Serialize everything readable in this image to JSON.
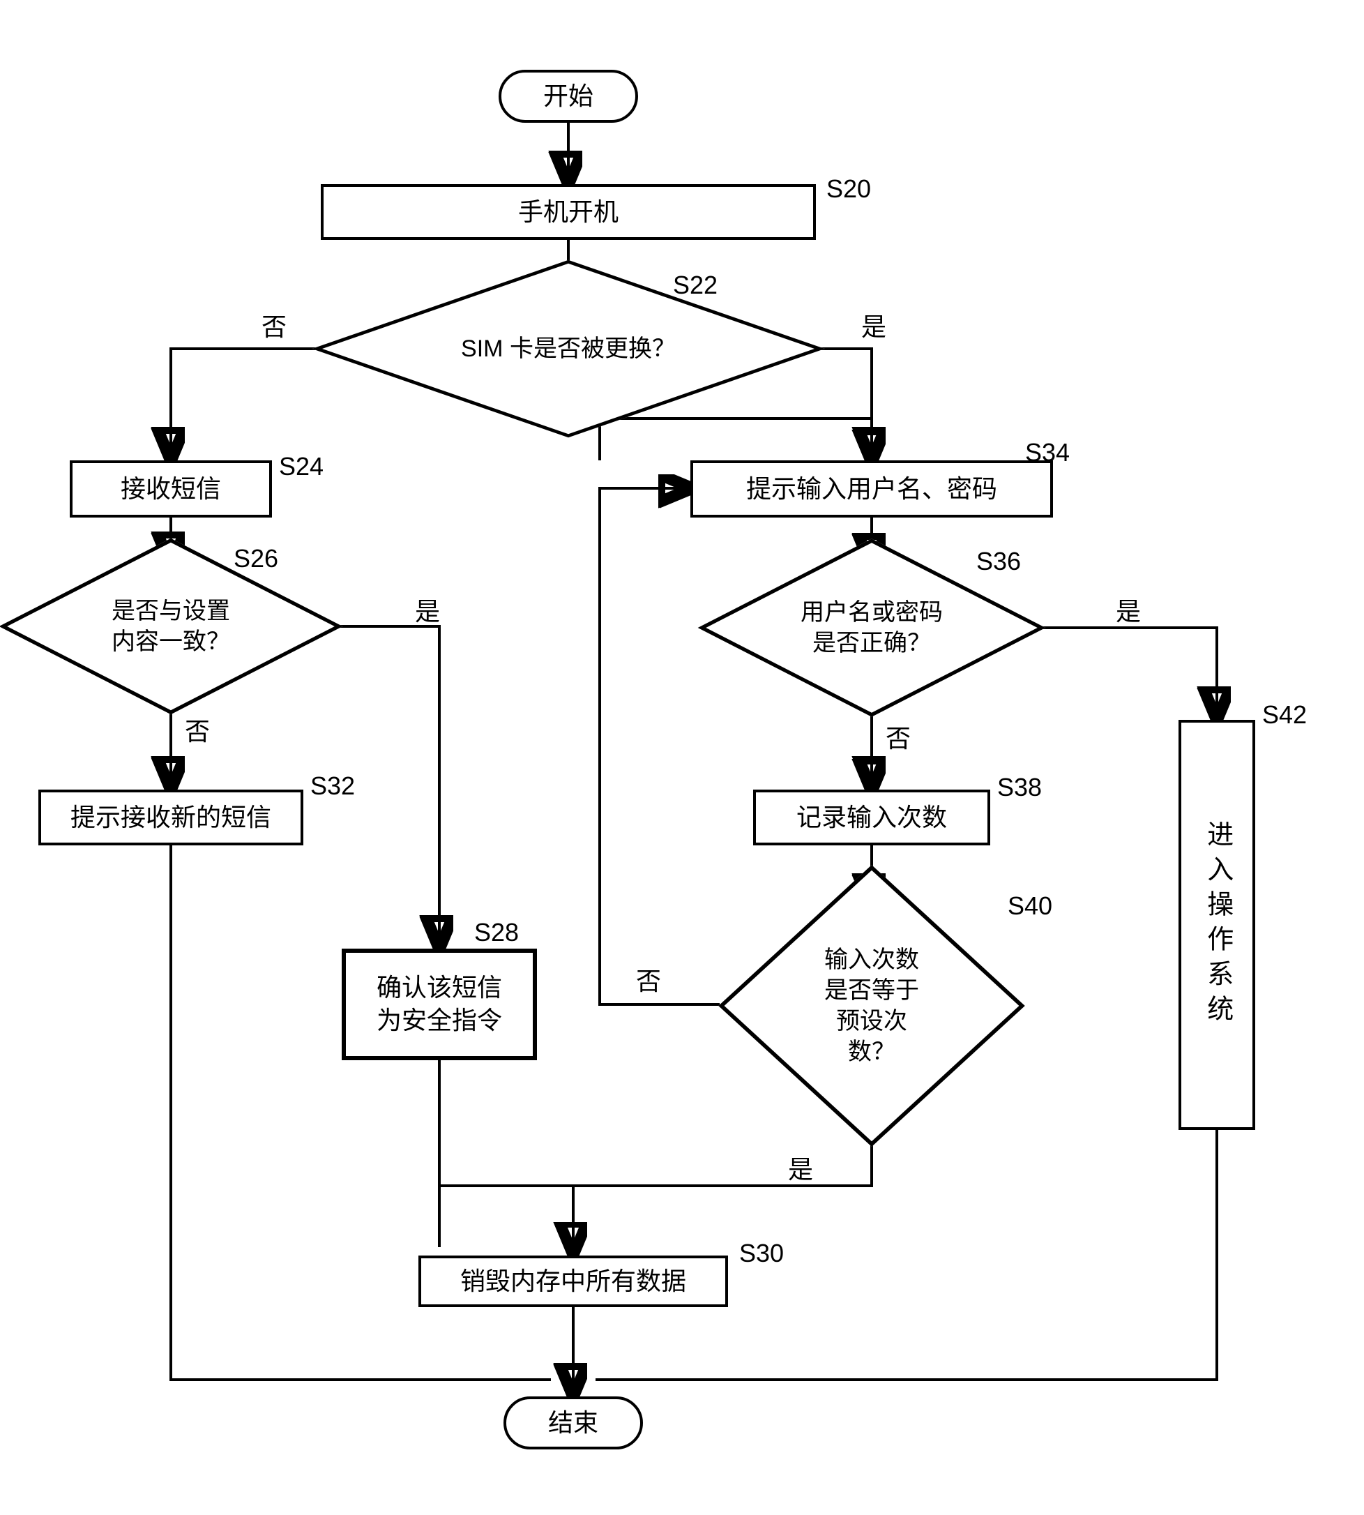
{
  "nodes": {
    "start": "开始",
    "end": "结束",
    "s20": "手机开机",
    "s22": "SIM 卡是否被更换？",
    "s24": "接收短信",
    "s26": "是否与设置\n内容一致？",
    "s28": "确认该短信\n为安全指令",
    "s30": "销毁内存中所有数据",
    "s32": "提示接收新的短信",
    "s34": "提示输入用户名、密码",
    "s36": "用户名或密码\n是否正确？",
    "s38": "记录输入次数",
    "s40": "输入次数\n是否等于\n预设次\n数？",
    "s42": "进入操作系统"
  },
  "steps": {
    "s20": "S20",
    "s22": "S22",
    "s24": "S24",
    "s26": "S26",
    "s28": "S28",
    "s30": "S30",
    "s32": "S32",
    "s34": "S34",
    "s36": "S36",
    "s38": "S38",
    "s40": "S40",
    "s42": "S42"
  },
  "edges": {
    "yes": "是",
    "no": "否"
  }
}
